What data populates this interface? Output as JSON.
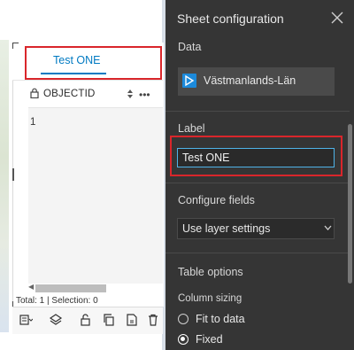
{
  "table_widget": {
    "tab_label": "Test ONE",
    "column_header": "OBJECTID",
    "rows": [
      "1"
    ],
    "status": "Total: 1 | Selection: 0",
    "toolbar_icons": [
      "map-layers-icon",
      "layers-icon",
      "unlock-icon",
      "copy-icon",
      "export-csv-icon",
      "delete-icon"
    ]
  },
  "panel": {
    "title": "Sheet configuration",
    "data_section": "Data",
    "layer_name": "Västmanlands-Län",
    "label_section": "Label",
    "label_value": "Test ONE",
    "configure_fields_section": "Configure fields",
    "configure_fields_value": "Use layer settings",
    "table_options_section": "Table options",
    "column_sizing_label": "Column sizing",
    "column_sizing_options": [
      {
        "label": "Fit to data",
        "selected": false
      },
      {
        "label": "Fixed",
        "selected": true
      }
    ]
  },
  "colors": {
    "accent": "#007ac2",
    "highlight_box": "#d9262b",
    "panel_bg": "#353535",
    "layer_icon": "#1c8adb"
  }
}
